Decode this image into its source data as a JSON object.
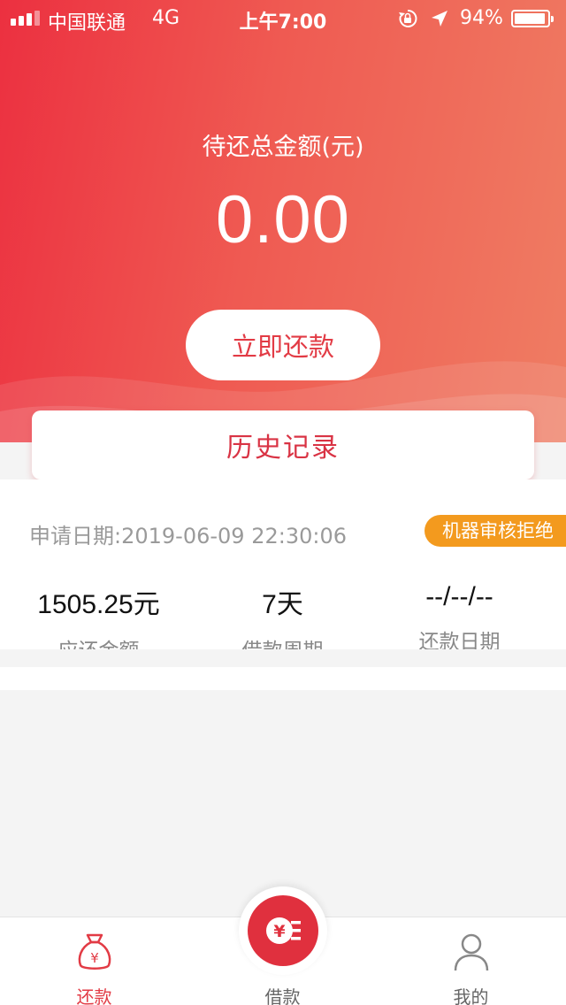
{
  "status_bar": {
    "carrier": "中国联通",
    "network": "4G",
    "time": "上午7:00",
    "battery_percent": "94%",
    "battery_level": 0.94
  },
  "summary": {
    "label": "待还总金额(元)",
    "amount": "0.00",
    "repay_button": "立即还款"
  },
  "history": {
    "title": "历史记录"
  },
  "record": {
    "apply_date": "申请日期:2019-06-09 22:30:06",
    "status": "机器审核拒绝",
    "stats": [
      {
        "value": "1505.25元",
        "label": "应还金额"
      },
      {
        "value": "7天",
        "label": "借款周期"
      },
      {
        "value": "--/--/--",
        "label": "还款日期"
      }
    ]
  },
  "tab_bar": {
    "tabs": [
      {
        "label": "还款",
        "icon": "money-bag-icon",
        "active": true
      },
      {
        "label": "借款",
        "icon": "yuan-coin-icon",
        "active": false
      },
      {
        "label": "我的",
        "icon": "user-icon",
        "active": false
      }
    ]
  },
  "colors": {
    "brand_red": "#e23b45",
    "gradient_start": "#ec3040",
    "gradient_end": "#ef7d63",
    "badge_orange": "#f39a1e"
  }
}
